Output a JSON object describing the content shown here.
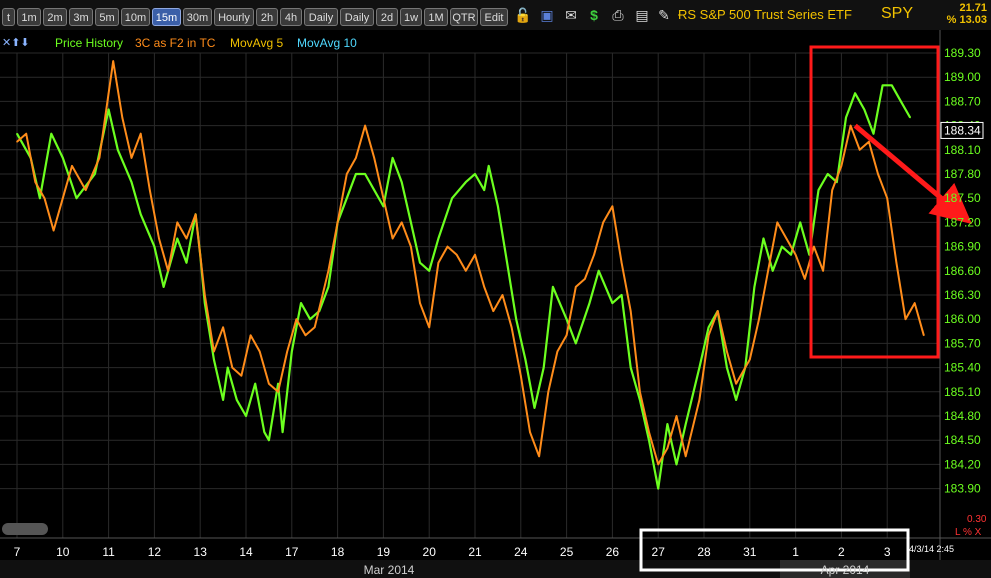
{
  "toolbar": {
    "tabs": [
      "t",
      "1m",
      "2m",
      "3m",
      "5m",
      "10m",
      "15m",
      "30m",
      "Hourly",
      "2h",
      "4h",
      "Daily",
      "Daily",
      "2d",
      "1w",
      "1M",
      "QTR",
      "Edit"
    ],
    "active_tab": "15m",
    "title": "ɌS S&P 500 Trust Series ETF",
    "ticker": "SPY",
    "change_value": "21.71",
    "change_pct": "% 13.03"
  },
  "legend": {
    "arrows": "✕⬆⬇",
    "price": "Price History",
    "indicator": "3C as F2 in TC",
    "ma5": "MovAvg 5",
    "ma10": "MovAvg 10",
    "colors": {
      "price": "#6cff1f",
      "indicator": "#ff8c1a",
      "ma5": "#f2c200",
      "ma10": "#4fd9ff"
    }
  },
  "chart_data": {
    "type": "line",
    "title": "",
    "y_ticks": [
      "189.30",
      "189.00",
      "188.70",
      "188.40",
      "188.10",
      "187.80",
      "187.50",
      "187.20",
      "186.90",
      "186.60",
      "186.30",
      "186.00",
      "185.70",
      "185.40",
      "185.10",
      "184.80",
      "184.50",
      "184.20",
      "183.90"
    ],
    "ylim": [
      183.8,
      189.45
    ],
    "last_price_label": "188.34",
    "x_ticks": [
      "7",
      "10",
      "11",
      "12",
      "13",
      "14",
      "17",
      "18",
      "19",
      "20",
      "21",
      "24",
      "25",
      "26",
      "27",
      "28",
      "31",
      "1",
      "2",
      "3"
    ],
    "month_labels": [
      "Mar 2014",
      "Apr 2014"
    ],
    "bottom_right_value": "0.30",
    "bottom_right_icons": "L % X",
    "timestamp": "4/3/14 2:45",
    "series": [
      {
        "name": "Price History",
        "color": "#6cff1f",
        "points": [
          [
            0,
            188.3
          ],
          [
            0.3,
            188.0
          ],
          [
            0.5,
            187.5
          ],
          [
            0.75,
            188.3
          ],
          [
            1.0,
            188.0
          ],
          [
            1.3,
            187.5
          ],
          [
            1.7,
            187.8
          ],
          [
            2.0,
            188.6
          ],
          [
            2.2,
            188.1
          ],
          [
            2.5,
            187.7
          ],
          [
            2.7,
            187.3
          ],
          [
            3.0,
            186.9
          ],
          [
            3.2,
            186.4
          ],
          [
            3.5,
            187.0
          ],
          [
            3.7,
            186.7
          ],
          [
            3.9,
            187.3
          ],
          [
            4.0,
            186.8
          ],
          [
            4.1,
            186.2
          ],
          [
            4.3,
            185.5
          ],
          [
            4.5,
            185.0
          ],
          [
            4.6,
            185.4
          ],
          [
            4.8,
            185.0
          ],
          [
            5.0,
            184.8
          ],
          [
            5.2,
            185.2
          ],
          [
            5.4,
            184.6
          ],
          [
            5.5,
            184.5
          ],
          [
            5.7,
            185.2
          ],
          [
            5.8,
            184.6
          ],
          [
            6.0,
            185.6
          ],
          [
            6.2,
            186.2
          ],
          [
            6.4,
            186.0
          ],
          [
            6.6,
            186.1
          ],
          [
            6.8,
            186.4
          ],
          [
            7.0,
            187.2
          ],
          [
            7.2,
            187.5
          ],
          [
            7.4,
            187.8
          ],
          [
            7.6,
            187.8
          ],
          [
            7.8,
            187.6
          ],
          [
            8.0,
            187.4
          ],
          [
            8.2,
            188.0
          ],
          [
            8.4,
            187.7
          ],
          [
            8.6,
            187.2
          ],
          [
            8.8,
            186.7
          ],
          [
            9.0,
            186.6
          ],
          [
            9.2,
            187.0
          ],
          [
            9.5,
            187.5
          ],
          [
            9.8,
            187.7
          ],
          [
            10.0,
            187.8
          ],
          [
            10.2,
            187.6
          ],
          [
            10.3,
            187.9
          ],
          [
            10.5,
            187.4
          ],
          [
            10.7,
            186.7
          ],
          [
            10.9,
            186.0
          ],
          [
            11.1,
            185.5
          ],
          [
            11.3,
            184.9
          ],
          [
            11.5,
            185.4
          ],
          [
            11.7,
            186.4
          ],
          [
            12.0,
            186.0
          ],
          [
            12.2,
            185.7
          ],
          [
            12.5,
            186.2
          ],
          [
            12.7,
            186.6
          ],
          [
            13.0,
            186.2
          ],
          [
            13.2,
            186.3
          ],
          [
            13.4,
            185.4
          ],
          [
            13.6,
            185.0
          ],
          [
            13.8,
            184.5
          ],
          [
            14.0,
            183.9
          ],
          [
            14.2,
            184.7
          ],
          [
            14.4,
            184.2
          ],
          [
            14.6,
            184.7
          ],
          [
            14.9,
            185.4
          ],
          [
            15.1,
            185.9
          ],
          [
            15.3,
            186.1
          ],
          [
            15.5,
            185.4
          ],
          [
            15.7,
            185.0
          ],
          [
            15.9,
            185.4
          ],
          [
            16.1,
            186.4
          ],
          [
            16.3,
            187.0
          ],
          [
            16.5,
            186.6
          ],
          [
            16.7,
            186.9
          ],
          [
            16.9,
            186.8
          ],
          [
            17.1,
            187.2
          ],
          [
            17.3,
            186.8
          ],
          [
            17.5,
            187.6
          ],
          [
            17.7,
            187.8
          ],
          [
            17.9,
            187.7
          ],
          [
            18.1,
            188.5
          ],
          [
            18.3,
            188.8
          ],
          [
            18.5,
            188.6
          ],
          [
            18.7,
            188.3
          ],
          [
            18.9,
            188.9
          ],
          [
            19.1,
            188.9
          ],
          [
            19.3,
            188.7
          ],
          [
            19.5,
            188.5
          ]
        ]
      },
      {
        "name": "3C as F2 in TC",
        "color": "#ff8c1a",
        "points": [
          [
            0,
            188.2
          ],
          [
            0.2,
            188.3
          ],
          [
            0.4,
            187.7
          ],
          [
            0.6,
            187.5
          ],
          [
            0.8,
            187.1
          ],
          [
            1.0,
            187.5
          ],
          [
            1.2,
            187.9
          ],
          [
            1.5,
            187.6
          ],
          [
            1.8,
            188.0
          ],
          [
            2.0,
            188.8
          ],
          [
            2.1,
            189.2
          ],
          [
            2.3,
            188.5
          ],
          [
            2.5,
            188.0
          ],
          [
            2.7,
            188.3
          ],
          [
            2.9,
            187.6
          ],
          [
            3.1,
            187.0
          ],
          [
            3.3,
            186.6
          ],
          [
            3.5,
            187.2
          ],
          [
            3.7,
            187.0
          ],
          [
            3.9,
            187.3
          ],
          [
            4.1,
            186.3
          ],
          [
            4.3,
            185.6
          ],
          [
            4.5,
            185.9
          ],
          [
            4.7,
            185.4
          ],
          [
            4.9,
            185.3
          ],
          [
            5.1,
            185.8
          ],
          [
            5.3,
            185.6
          ],
          [
            5.5,
            185.2
          ],
          [
            5.7,
            185.1
          ],
          [
            5.9,
            185.6
          ],
          [
            6.1,
            186.0
          ],
          [
            6.3,
            185.8
          ],
          [
            6.5,
            185.9
          ],
          [
            6.8,
            186.6
          ],
          [
            7.0,
            187.2
          ],
          [
            7.2,
            187.8
          ],
          [
            7.4,
            188.0
          ],
          [
            7.6,
            188.4
          ],
          [
            7.8,
            188.0
          ],
          [
            8.0,
            187.5
          ],
          [
            8.2,
            187.0
          ],
          [
            8.4,
            187.2
          ],
          [
            8.6,
            186.9
          ],
          [
            8.8,
            186.2
          ],
          [
            9.0,
            185.9
          ],
          [
            9.2,
            186.7
          ],
          [
            9.4,
            186.9
          ],
          [
            9.6,
            186.8
          ],
          [
            9.8,
            186.6
          ],
          [
            10.0,
            186.8
          ],
          [
            10.2,
            186.4
          ],
          [
            10.4,
            186.1
          ],
          [
            10.6,
            186.3
          ],
          [
            10.8,
            185.9
          ],
          [
            11.0,
            185.3
          ],
          [
            11.2,
            184.6
          ],
          [
            11.4,
            184.3
          ],
          [
            11.6,
            185.1
          ],
          [
            11.8,
            185.6
          ],
          [
            12.0,
            185.8
          ],
          [
            12.2,
            186.4
          ],
          [
            12.4,
            186.5
          ],
          [
            12.6,
            186.8
          ],
          [
            12.8,
            187.2
          ],
          [
            13.0,
            187.4
          ],
          [
            13.2,
            186.7
          ],
          [
            13.4,
            186.1
          ],
          [
            13.6,
            185.1
          ],
          [
            13.8,
            184.6
          ],
          [
            14.0,
            184.2
          ],
          [
            14.2,
            184.4
          ],
          [
            14.4,
            184.8
          ],
          [
            14.6,
            184.3
          ],
          [
            14.9,
            185.0
          ],
          [
            15.1,
            185.8
          ],
          [
            15.3,
            186.1
          ],
          [
            15.5,
            185.6
          ],
          [
            15.7,
            185.2
          ],
          [
            16.0,
            185.5
          ],
          [
            16.2,
            186.0
          ],
          [
            16.4,
            186.6
          ],
          [
            16.6,
            187.2
          ],
          [
            16.8,
            187.0
          ],
          [
            17.0,
            186.8
          ],
          [
            17.2,
            186.5
          ],
          [
            17.4,
            186.9
          ],
          [
            17.6,
            186.6
          ],
          [
            17.8,
            187.6
          ],
          [
            18.0,
            187.9
          ],
          [
            18.2,
            188.4
          ],
          [
            18.4,
            188.1
          ],
          [
            18.6,
            188.2
          ],
          [
            18.8,
            187.8
          ],
          [
            19.0,
            187.5
          ],
          [
            19.2,
            186.7
          ],
          [
            19.4,
            186.0
          ],
          [
            19.6,
            186.2
          ],
          [
            19.8,
            185.8
          ]
        ]
      }
    ],
    "annotations": [
      {
        "type": "arrow",
        "color": "#ff1a1a",
        "from": [
          18.3,
          188.4
        ],
        "to": [
          20.6,
          187.3
        ]
      },
      {
        "type": "rect",
        "color": "#ff1a1a",
        "x_range": [
          17.3,
          20.0
        ],
        "y_range": [
          185.6,
          189.35
        ]
      },
      {
        "type": "rect",
        "color": "#ffffff",
        "label": "x-axis highlight",
        "x_range": [
          14.0,
          19.6
        ],
        "y_range": [
          183.55,
          183.3
        ]
      }
    ]
  }
}
